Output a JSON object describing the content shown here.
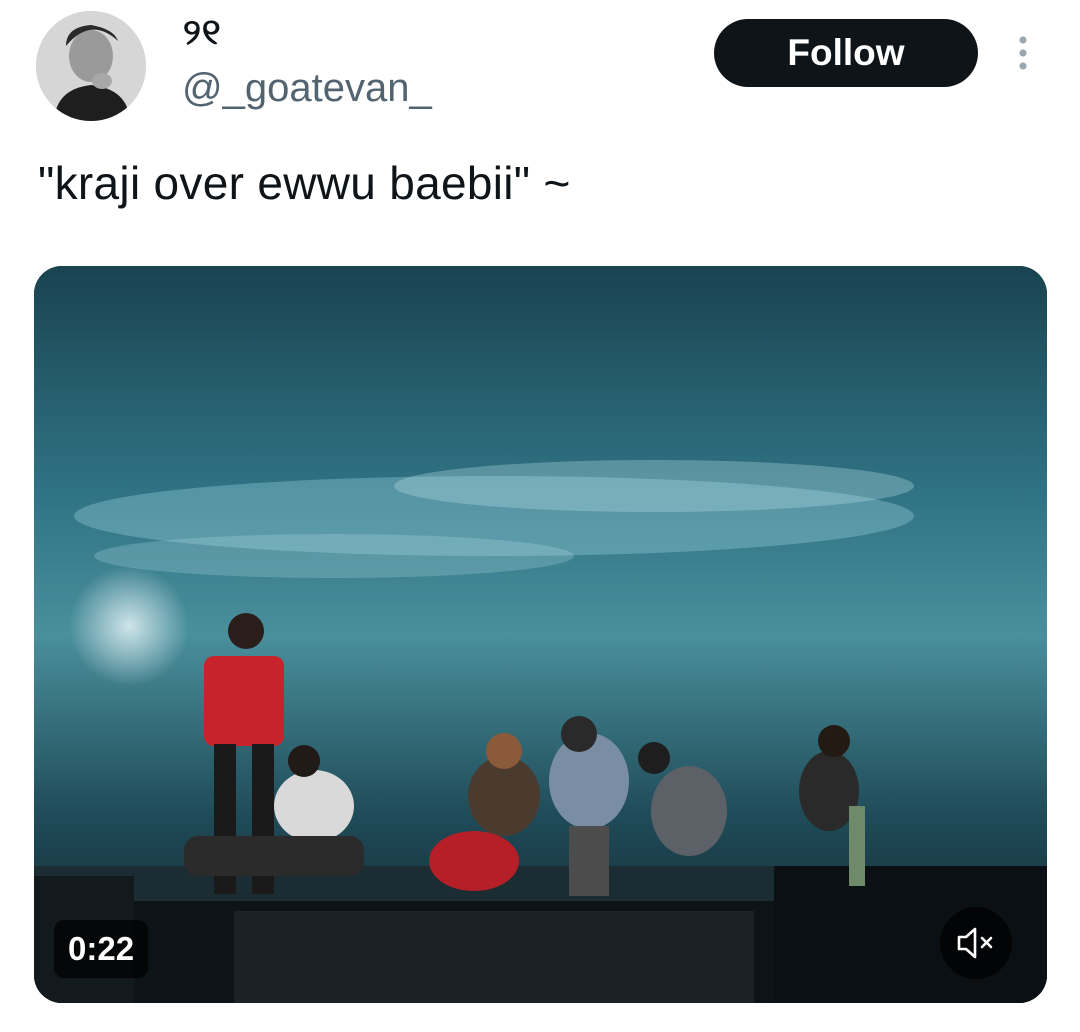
{
  "author": {
    "display_name": "୨୧",
    "handle": "@_goatevan_",
    "avatar_icon": "profile-photo"
  },
  "follow": {
    "label": "Follow"
  },
  "more": {
    "icon": "more-vertical-icon"
  },
  "tweet": {
    "text": "\"kraji over ewwu baebii\" ~"
  },
  "video": {
    "duration": "0:22",
    "mute_icon": "speaker-muted-icon"
  },
  "colors": {
    "text_primary": "#0f1419",
    "text_secondary": "#536471",
    "button_bg": "#0f1419"
  }
}
